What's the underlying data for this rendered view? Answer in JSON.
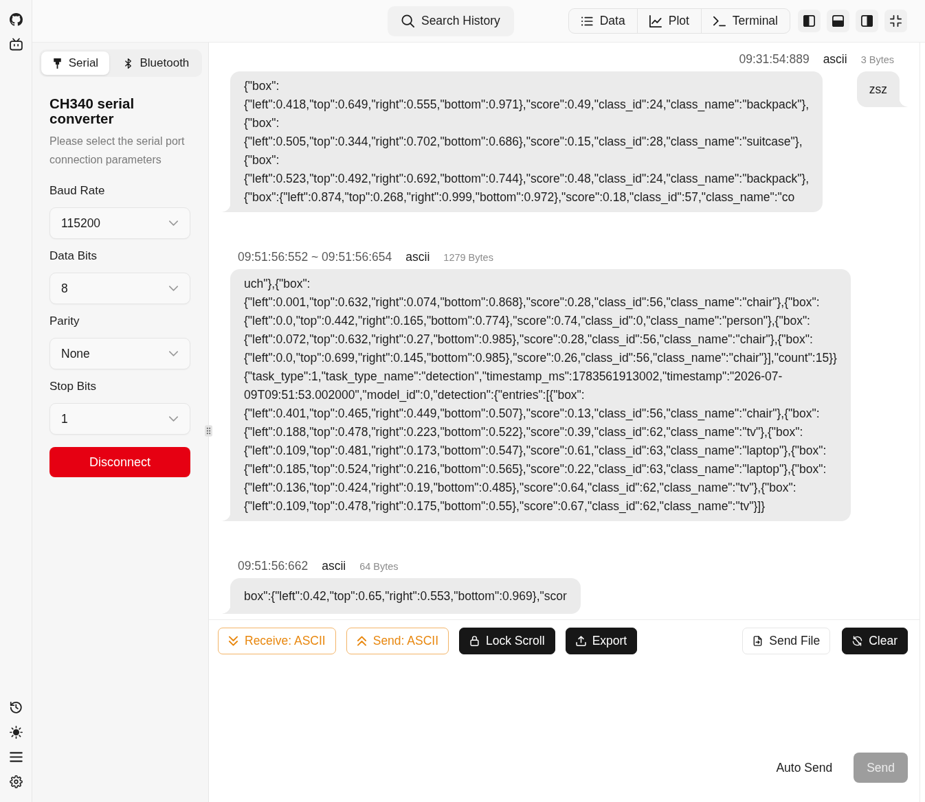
{
  "topbar": {
    "search": {
      "label": "Search History"
    },
    "views": [
      {
        "label": "Data"
      },
      {
        "label": "Plot"
      },
      {
        "label": "Terminal"
      }
    ]
  },
  "connection": {
    "tabs": [
      {
        "label": "Serial",
        "selected": true
      },
      {
        "label": "Bluetooth",
        "selected": false
      }
    ],
    "title": "CH340 serial converter",
    "description": "Please select the serial port connection parameters",
    "fields": [
      {
        "label": "Baud Rate",
        "value": "115200"
      },
      {
        "label": "Data Bits",
        "value": "8"
      },
      {
        "label": "Parity",
        "value": "None"
      },
      {
        "label": "Stop Bits",
        "value": "1"
      }
    ],
    "disconnect_button": "Disconnect"
  },
  "log": [
    {
      "kind": "sent",
      "time": "09:31:54:889",
      "encoding": "ascii",
      "bytes": "3 Bytes",
      "text": "zsz"
    },
    {
      "kind": "received",
      "text": "{\"box\":\n{\"left\":0.418,\"top\":0.649,\"right\":0.555,\"bottom\":0.971},\"score\":0.49,\"class_id\":24,\"class_name\":\"backpack\"},\n{\"box\":\n{\"left\":0.505,\"top\":0.344,\"right\":0.702,\"bottom\":0.686},\"score\":0.15,\"class_id\":28,\"class_name\":\"suitcase\"},\n{\"box\":\n{\"left\":0.523,\"top\":0.492,\"right\":0.692,\"bottom\":0.744},\"score\":0.48,\"class_id\":24,\"class_name\":\"backpack\"},\n{\"box\":{\"left\":0.874,\"top\":0.268,\"right\":0.999,\"bottom\":0.972},\"score\":0.18,\"class_id\":57,\"class_name\":\"co"
    },
    {
      "kind": "received",
      "time": "09:51:56:552 ~ 09:51:56:654",
      "encoding": "ascii",
      "bytes": "1279 Bytes",
      "text": "uch\"},{\"box\":\n{\"left\":0.001,\"top\":0.632,\"right\":0.074,\"bottom\":0.868},\"score\":0.28,\"class_id\":56,\"class_name\":\"chair\"},{\"box\":\n{\"left\":0.0,\"top\":0.442,\"right\":0.165,\"bottom\":0.774},\"score\":0.74,\"class_id\":0,\"class_name\":\"person\"},{\"box\":\n{\"left\":0.072,\"top\":0.632,\"right\":0.27,\"bottom\":0.985},\"score\":0.28,\"class_id\":56,\"class_name\":\"chair\"},{\"box\":\n{\"left\":0.0,\"top\":0.699,\"right\":0.145,\"bottom\":0.985},\"score\":0.26,\"class_id\":56,\"class_name\":\"chair\"}],\"count\":15}}\n{\"task_type\":1,\"task_type_name\":\"detection\",\"timestamp_ms\":1783561913002,\"timestamp\":\"2026-07-\n09T09:51:53.002000\",\"model_id\":0,\"detection\":{\"entries\":[{\"box\":\n{\"left\":0.401,\"top\":0.465,\"right\":0.449,\"bottom\":0.507},\"score\":0.13,\"class_id\":56,\"class_name\":\"chair\"},{\"box\":\n{\"left\":0.188,\"top\":0.478,\"right\":0.223,\"bottom\":0.522},\"score\":0.39,\"class_id\":62,\"class_name\":\"tv\"},{\"box\":\n{\"left\":0.109,\"top\":0.481,\"right\":0.173,\"bottom\":0.547},\"score\":0.61,\"class_id\":63,\"class_name\":\"laptop\"},{\"box\":\n{\"left\":0.185,\"top\":0.524,\"right\":0.216,\"bottom\":0.565},\"score\":0.22,\"class_id\":63,\"class_name\":\"laptop\"},{\"box\":\n{\"left\":0.136,\"top\":0.424,\"right\":0.19,\"bottom\":0.485},\"score\":0.64,\"class_id\":62,\"class_name\":\"tv\"},{\"box\":\n{\"left\":0.109,\"top\":0.478,\"right\":0.175,\"bottom\":0.55},\"score\":0.67,\"class_id\":62,\"class_name\":\"tv\"}]}"
    },
    {
      "kind": "received",
      "time": "09:51:56:662",
      "encoding": "ascii",
      "bytes": "64 Bytes",
      "text": "box\":{\"left\":0.42,\"top\":0.65,\"right\":0.553,\"bottom\":0.969},\"scor"
    }
  ],
  "toolbar": {
    "left_buttons": [
      {
        "label": "Receive: ASCII",
        "kind": "format"
      },
      {
        "label": "Send: ASCII",
        "kind": "format"
      },
      {
        "label": "Lock Scroll",
        "kind": "dark"
      },
      {
        "label": "Export",
        "kind": "dark"
      }
    ],
    "right_buttons": [
      {
        "label": "Send File",
        "kind": "light"
      },
      {
        "label": "Clear",
        "kind": "dark"
      }
    ]
  },
  "composer": {
    "auto_send_label": "Auto Send",
    "send_button": {
      "label": "Send",
      "disabled": true
    }
  }
}
